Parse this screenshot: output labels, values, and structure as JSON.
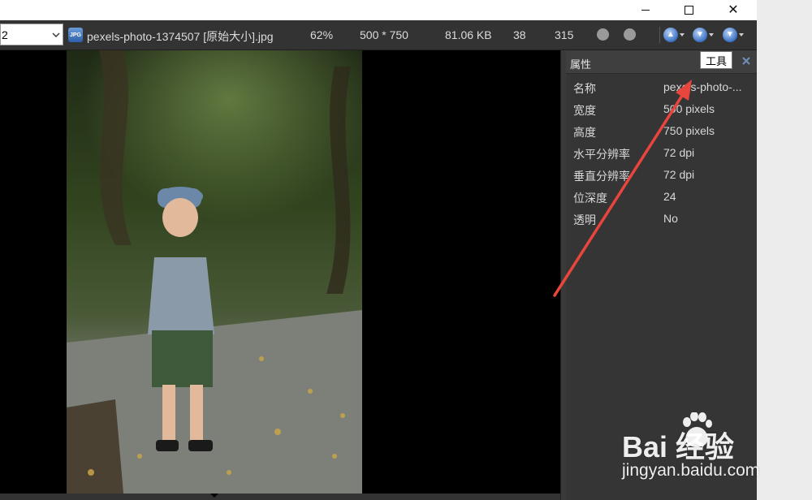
{
  "window": {
    "buttons": {
      "minimize": "minimize",
      "maximize": "maximize",
      "close": "close"
    }
  },
  "toolbar": {
    "zoom_value": "2",
    "file_icon_label": "JPG",
    "filename": "pexels-photo-1374507 [原始大小].jpg",
    "zoom_percent": "62%",
    "dimensions": "500 * 750",
    "file_size": "81.06 KB",
    "index": "38",
    "count": "315",
    "nav_icons": [
      "up-arrow-icon",
      "down-arrow-icon",
      "down-arrow-icon"
    ]
  },
  "properties_panel": {
    "title": "属性",
    "tooltip": "工具",
    "rows": [
      {
        "key": "名称",
        "value": "pexels-photo-..."
      },
      {
        "key": "宽度",
        "value": "500 pixels"
      },
      {
        "key": "高度",
        "value": "750 pixels"
      },
      {
        "key": "水平分辨率",
        "value": "72 dpi"
      },
      {
        "key": "垂直分辨率",
        "value": "72 dpi"
      },
      {
        "key": "位深度",
        "value": "24"
      },
      {
        "key": "透明",
        "value": "No"
      }
    ]
  },
  "watermark": {
    "logo_text": "Bai  经验",
    "url": "jingyan.baidu.com"
  },
  "colors": {
    "app_bg": "#2b2b2b",
    "panel_bg": "#353535",
    "annotation_arrow": "#e8453c"
  }
}
